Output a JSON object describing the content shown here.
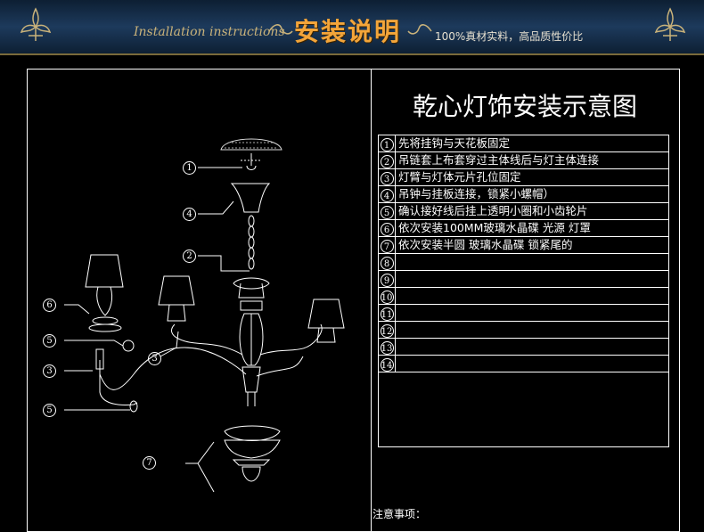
{
  "banner": {
    "script_text": "Installation instructions",
    "title": "安装说明",
    "slogan": "100%真材实料，高品质性价比",
    "colors": {
      "background": "#1d3a5c",
      "title": "#f3a53a",
      "ornament": "#c9b27a"
    }
  },
  "diagram": {
    "title": "乾心灯饰安装示意图",
    "steps": [
      {
        "num": "1",
        "text": "先将挂钩与天花板固定"
      },
      {
        "num": "2",
        "text": "吊链套上布套穿过主体线后与灯主体连接"
      },
      {
        "num": "3",
        "text": "灯臂与灯体元片孔位固定"
      },
      {
        "num": "4",
        "text": "吊钟与挂板连接，锁紧小螺帽）"
      },
      {
        "num": "5",
        "text": "确认接好线后挂上透明小圈和小齿轮片"
      },
      {
        "num": "6",
        "text": "依次安装100MM玻璃水晶碟  光源  灯罩"
      },
      {
        "num": "7",
        "text": "依次安装半圆  玻璃水晶碟    锁紧尾的"
      },
      {
        "num": "8",
        "text": ""
      },
      {
        "num": "9",
        "text": ""
      },
      {
        "num": "10",
        "text": ""
      },
      {
        "num": "11",
        "text": ""
      },
      {
        "num": "12",
        "text": ""
      },
      {
        "num": "13",
        "text": ""
      },
      {
        "num": "14",
        "text": ""
      }
    ],
    "callouts": [
      "1",
      "4",
      "2",
      "6",
      "5",
      "3",
      "3",
      "5",
      "7"
    ],
    "notes_label": "注意事项："
  }
}
